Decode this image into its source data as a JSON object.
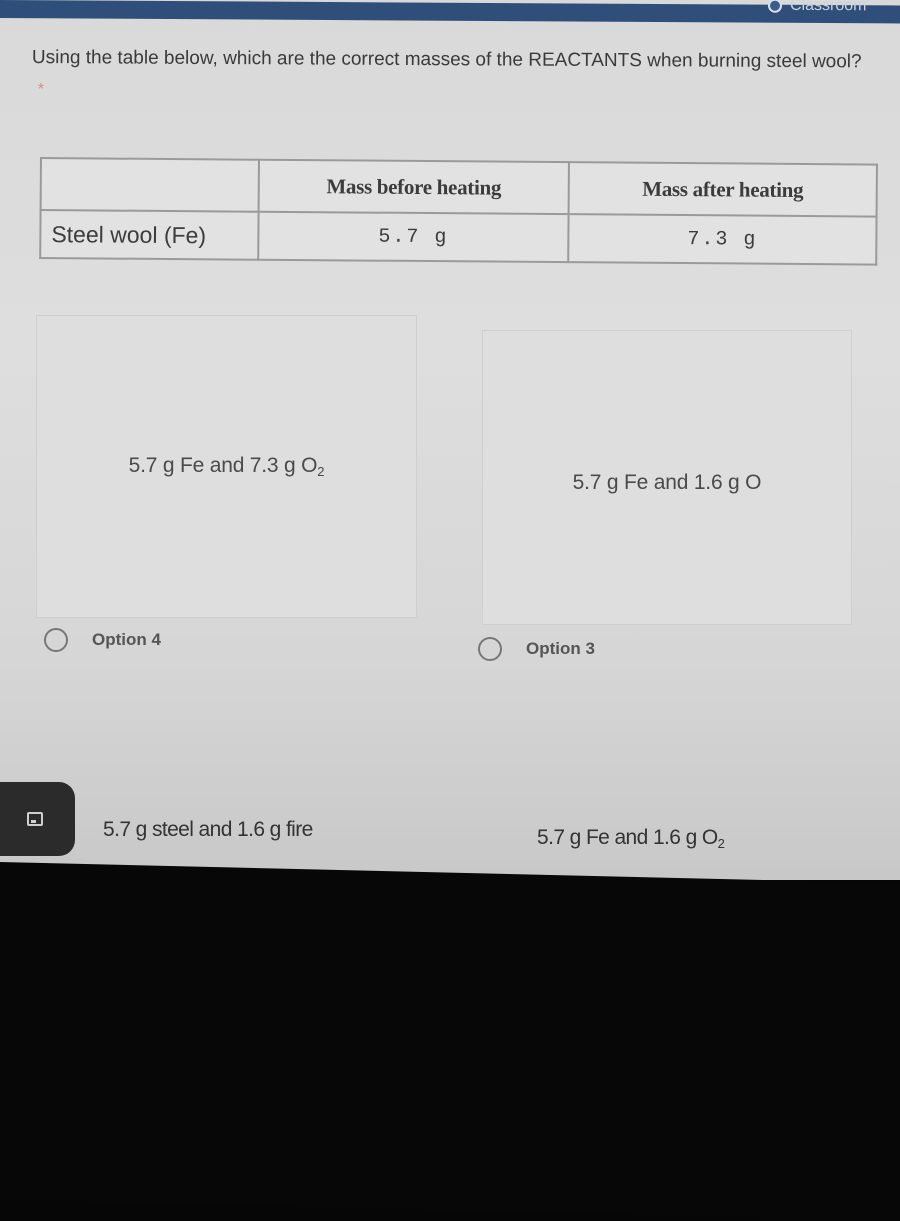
{
  "top_bar": {
    "partial_text": "Classroom"
  },
  "question": {
    "text": "Using the table below, which are the correct masses of the REACTANTS when burning steel wool?",
    "required_marker": "*"
  },
  "table": {
    "headers": [
      "",
      "Mass before heating",
      "Mass after heating"
    ],
    "rows": [
      {
        "label": "Steel wool (Fe)",
        "before": "5.7 g",
        "after": "7.3 g"
      }
    ]
  },
  "options": [
    {
      "label": "Option 4",
      "image_text_main": "5.7 g Fe and 7.3 g O",
      "image_text_sub": "2",
      "selected": false
    },
    {
      "label": "Option 3",
      "image_text_main": "5.7 g Fe and 1.6 g O",
      "image_text_sub": "",
      "selected": false
    },
    {
      "label": "",
      "image_text_main": "5.7 g steel and 1.6 g fire",
      "image_text_sub": "",
      "selected": false
    },
    {
      "label": "",
      "image_text_main": "5.7 g Fe and 1.6 g O",
      "image_text_sub": "2",
      "selected": false
    }
  ],
  "colors": {
    "top_bar": "#2f4f7a",
    "page_background": "#dcdcdc",
    "required_star": "#d98a8a",
    "text": "#3a3a3a",
    "bezel": "#070707"
  }
}
